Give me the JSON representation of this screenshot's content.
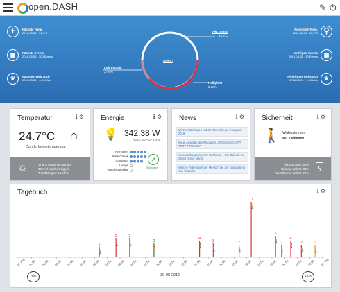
{
  "app": {
    "logo_text": "open.DASH"
  },
  "header": {
    "edit_icon": "edit-icon",
    "power_icon": "power-icon"
  },
  "hero": {
    "left": [
      {
        "title": "Nächste Temp.",
        "sub": "2016-08-30 · 34,4°C",
        "icon": "plus-icon"
      },
      {
        "title": "Nächste Events",
        "sub": "2016-08-31 · 300 Events",
        "icon": "calendar-icon"
      },
      {
        "title": "Nächster Verbrauch",
        "sub": "2016-08-31 · 4,36 kWh",
        "icon": "leaf-icon"
      }
    ],
    "right": [
      {
        "title": "Niedrigste Temp.",
        "sub": "2016-08-30 · 18,8°C",
        "icon": "thermometer-icon"
      },
      {
        "title": "Niedrigste Events",
        "sub": "2016-08-31 · 10 Events",
        "icon": "calendar-icon"
      },
      {
        "title": "Niedrigster Verbrauch",
        "sub": "2016-08-31 · 1,45 kWh",
        "icon": "leaf-icon"
      }
    ],
    "gauge": {
      "center": "Balkon",
      "akt_temp_label": "Akt. Temp.",
      "akt_temp_value": "34.6°C",
      "luft_label": "Luft Feucht.",
      "luft_value": "27.6%",
      "hell_label": "Helligkeit",
      "hell_value": "8.32%"
    }
  },
  "cards": {
    "temperatur": {
      "title": "Temperatur",
      "value": "24.7°C",
      "sub": "Durch. Innentemperatur",
      "f1": "17.5°C Aussentemperatur",
      "f2": "93% rel. Luftfeuchtigkeit",
      "f3": "Trend Morgen: 18.91°C"
    },
    "energie": {
      "title": "Energie",
      "value": "342.38 W",
      "sub": "Diese Woche: 2.47€",
      "devices": [
        "Fernseher",
        "Kühlschrank",
        "Computer",
        "Lampe",
        "Waschmaschine"
      ],
      "eco_label": "Wachstum"
    },
    "news": {
      "title": "News",
      "items": [
        "Mit zwei Beiträgen auf der Mensch und Computer 2016",
        "Neue Ausgabe des Magazins „WISSENSCHAFT TRIFFT PRAXIS“",
        "Veranstaltungshinweis: Gut smart – Die Zukunft im Smart Home Markt",
        "Welche Rolle spielt der Mensch bei der Entwicklung von Technik?"
      ]
    },
    "sicherheit": {
      "title": "Sicherheit",
      "room": "Wohnzimmer",
      "ago": "vor 2 Minuten",
      "f1": "Heizung Büro: 52%",
      "f2": "Heizung Wohnz: 84%",
      "f3": "Raumthermo Wohnz: 71%"
    }
  },
  "tagebuch": {
    "title": "Tagebuch",
    "date": "30-08-2016",
    "prev": "-24h",
    "next": "+24h",
    "ticks": [
      "31. Aug",
      "01:00",
      "02:00",
      "03:00",
      "04:00",
      "05:00",
      "06:00",
      "07:00",
      "08:00",
      "09:00",
      "10:00",
      "11:00",
      "12:00",
      "13:00",
      "14:00",
      "15:00",
      "16:00",
      "17:00",
      "18:00",
      "19:00",
      "20:00",
      "21:00",
      "22:00",
      "23:00",
      "31. Aug"
    ],
    "events": [
      {
        "x": 0.265,
        "h": 15,
        "label": "1",
        "color": "#d9303a"
      },
      {
        "x": 0.32,
        "h": 28,
        "label": "5",
        "color": "#d9303a"
      },
      {
        "x": 0.365,
        "h": 28,
        "label": "5",
        "color": "#d9303a"
      },
      {
        "x": 0.445,
        "h": 20,
        "label": "2",
        "color": "#2e7d32"
      },
      {
        "x": 0.595,
        "h": 24,
        "label": "4",
        "color": "#d9303a"
      },
      {
        "x": 0.64,
        "h": 20,
        "label": "3",
        "color": "#d9303a"
      },
      {
        "x": 0.725,
        "h": 18,
        "label": "2",
        "color": "#d9303a"
      },
      {
        "x": 0.765,
        "h": 80,
        "label": "17",
        "color": "#d9303a"
      },
      {
        "x": 0.845,
        "h": 31,
        "label": "6",
        "color": "#d9303a"
      },
      {
        "x": 0.865,
        "h": 18,
        "label": "2",
        "color": "#d9303a"
      },
      {
        "x": 0.895,
        "h": 24,
        "label": "4",
        "color": "#d9303a"
      },
      {
        "x": 0.93,
        "h": 18,
        "label": "2",
        "color": "#d9303a"
      },
      {
        "x": 0.975,
        "h": 18,
        "label": "2",
        "color": "#f0a020"
      }
    ]
  }
}
